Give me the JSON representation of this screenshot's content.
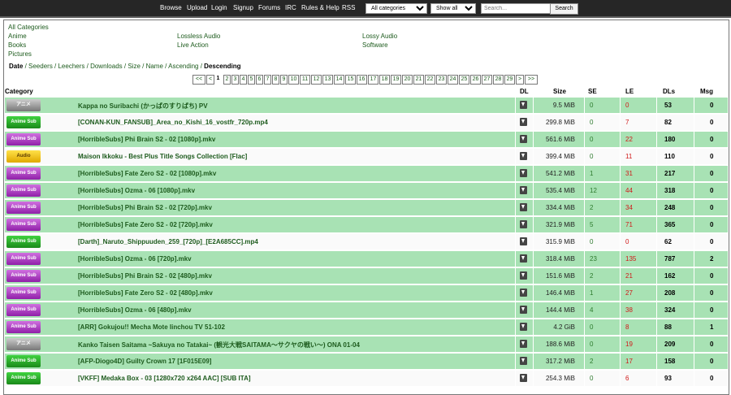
{
  "nav": [
    "Browse",
    "Upload",
    "Login",
    "Signup",
    "Forums",
    "IRC",
    "Rules & Help",
    "RSS"
  ],
  "filters": {
    "category": "All categories",
    "status": "Show all",
    "search_placeholder": "Search...",
    "search_button": "Search"
  },
  "categories": {
    "all": "All Categories",
    "col1": [
      "Anime",
      "Books",
      "Pictures"
    ],
    "col2": [
      "Lossless Audio",
      "Live Action"
    ],
    "col3": [
      "Lossy Audio",
      "Software"
    ]
  },
  "sort": {
    "items": [
      "Date",
      "Seeders",
      "Leechers",
      "Downloads",
      "Size",
      "Name",
      "Ascending",
      "Descending"
    ],
    "separator": " / "
  },
  "pager": {
    "first": "<<",
    "prev": "<",
    "pages": [
      "1",
      "2",
      "3",
      "4",
      "5",
      "6",
      "7",
      "8",
      "9",
      "10",
      "11",
      "12",
      "13",
      "14",
      "15",
      "16",
      "17",
      "18",
      "19",
      "20",
      "21",
      "22",
      "23",
      "24",
      "25",
      "26",
      "27",
      "28",
      "29"
    ],
    "next": ">",
    "last": ">>"
  },
  "table": {
    "headers": {
      "category": "Category",
      "dl": "DL",
      "size": "Size",
      "se": "SE",
      "le": "LE",
      "dls": "DLs",
      "msg": "Msg"
    },
    "rows": [
      {
        "cat": "raw",
        "cat_label": "アニメ",
        "name": "Kappa no Suribachi (かっぱのすりばち) PV",
        "size": "9.5 MiB",
        "se": "0",
        "le": "0",
        "dls": "53",
        "msg": "0",
        "bg": "green"
      },
      {
        "cat": "anime",
        "cat_label": "Anime Sub",
        "name": "[CONAN-KUN_FANSUB]_Area_no_Kishi_16_vostfr_720p.mp4",
        "size": "299.8 MiB",
        "se": "0",
        "le": "7",
        "dls": "82",
        "msg": "0",
        "bg": "white"
      },
      {
        "cat": "other",
        "cat_label": "Anime Sub",
        "name": "[HorribleSubs] Phi Brain S2 - 02 [1080p].mkv",
        "size": "561.6 MiB",
        "se": "0",
        "le": "22",
        "dls": "180",
        "msg": "0",
        "bg": "green"
      },
      {
        "cat": "audio",
        "cat_label": "Audio",
        "name": "Maison Ikkoku - Best Plus Title Songs Collection [Flac]",
        "size": "399.4 MiB",
        "se": "0",
        "le": "11",
        "dls": "110",
        "msg": "0",
        "bg": "white"
      },
      {
        "cat": "other",
        "cat_label": "Anime Sub",
        "name": "[HorribleSubs] Fate Zero S2 - 02 [1080p].mkv",
        "size": "541.2 MiB",
        "se": "1",
        "le": "31",
        "dls": "217",
        "msg": "0",
        "bg": "green"
      },
      {
        "cat": "other",
        "cat_label": "Anime Sub",
        "name": "[HorribleSubs] Ozma - 06 [1080p].mkv",
        "size": "535.4 MiB",
        "se": "12",
        "le": "44",
        "dls": "318",
        "msg": "0",
        "bg": "green"
      },
      {
        "cat": "other",
        "cat_label": "Anime Sub",
        "name": "[HorribleSubs] Phi Brain S2 - 02 [720p].mkv",
        "size": "334.4 MiB",
        "se": "2",
        "le": "34",
        "dls": "248",
        "msg": "0",
        "bg": "green"
      },
      {
        "cat": "other",
        "cat_label": "Anime Sub",
        "name": "[HorribleSubs] Fate Zero S2 - 02 [720p].mkv",
        "size": "321.9 MiB",
        "se": "5",
        "le": "71",
        "dls": "365",
        "msg": "0",
        "bg": "green"
      },
      {
        "cat": "anime",
        "cat_label": "Anime Sub",
        "name": "[Darth]_Naruto_Shippuuden_259_[720p]_[E2A685CC].mp4",
        "size": "315.9 MiB",
        "se": "0",
        "le": "0",
        "dls": "62",
        "msg": "0",
        "bg": "white"
      },
      {
        "cat": "other",
        "cat_label": "Anime Sub",
        "name": "[HorribleSubs] Ozma - 06 [720p].mkv",
        "size": "318.4 MiB",
        "se": "23",
        "le": "135",
        "dls": "787",
        "msg": "2",
        "bg": "green"
      },
      {
        "cat": "other",
        "cat_label": "Anime Sub",
        "name": "[HorribleSubs] Phi Brain S2 - 02 [480p].mkv",
        "size": "151.6 MiB",
        "se": "2",
        "le": "21",
        "dls": "162",
        "msg": "0",
        "bg": "green"
      },
      {
        "cat": "other",
        "cat_label": "Anime Sub",
        "name": "[HorribleSubs] Fate Zero S2 - 02 [480p].mkv",
        "size": "146.4 MiB",
        "se": "1",
        "le": "27",
        "dls": "208",
        "msg": "0",
        "bg": "green"
      },
      {
        "cat": "other",
        "cat_label": "Anime Sub",
        "name": "[HorribleSubs] Ozma - 06 [480p].mkv",
        "size": "144.4 MiB",
        "se": "4",
        "le": "38",
        "dls": "324",
        "msg": "0",
        "bg": "green"
      },
      {
        "cat": "other",
        "cat_label": "Anime Sub",
        "name": "[ARR] Gokujou!! Mecha Mote Iinchou TV 51-102",
        "size": "4.2 GiB",
        "se": "0",
        "le": "8",
        "dls": "88",
        "msg": "1",
        "bg": "green"
      },
      {
        "cat": "raw",
        "cat_label": "アニメ",
        "name": "Kanko Taisen Saitama ~Sakuya no Tatakai~ (観光大戦SAITAMA〜サクヤの戦い〜) ONA 01-04",
        "size": "188.6 MiB",
        "se": "0",
        "le": "19",
        "dls": "209",
        "msg": "0",
        "bg": "green"
      },
      {
        "cat": "anime",
        "cat_label": "Anime Sub",
        "name": "[AFP-Diogo4D] Guilty Crown 17 [1F015E09]",
        "size": "317.2 MiB",
        "se": "2",
        "le": "17",
        "dls": "158",
        "msg": "0",
        "bg": "green"
      },
      {
        "cat": "anime",
        "cat_label": "Anime Sub",
        "name": "[VKFF] Medaka Box - 03 [1280x720 x264 AAC] [SUB ITA]",
        "size": "254.3 MiB",
        "se": "0",
        "le": "6",
        "dls": "93",
        "msg": "0",
        "bg": "white"
      }
    ]
  }
}
